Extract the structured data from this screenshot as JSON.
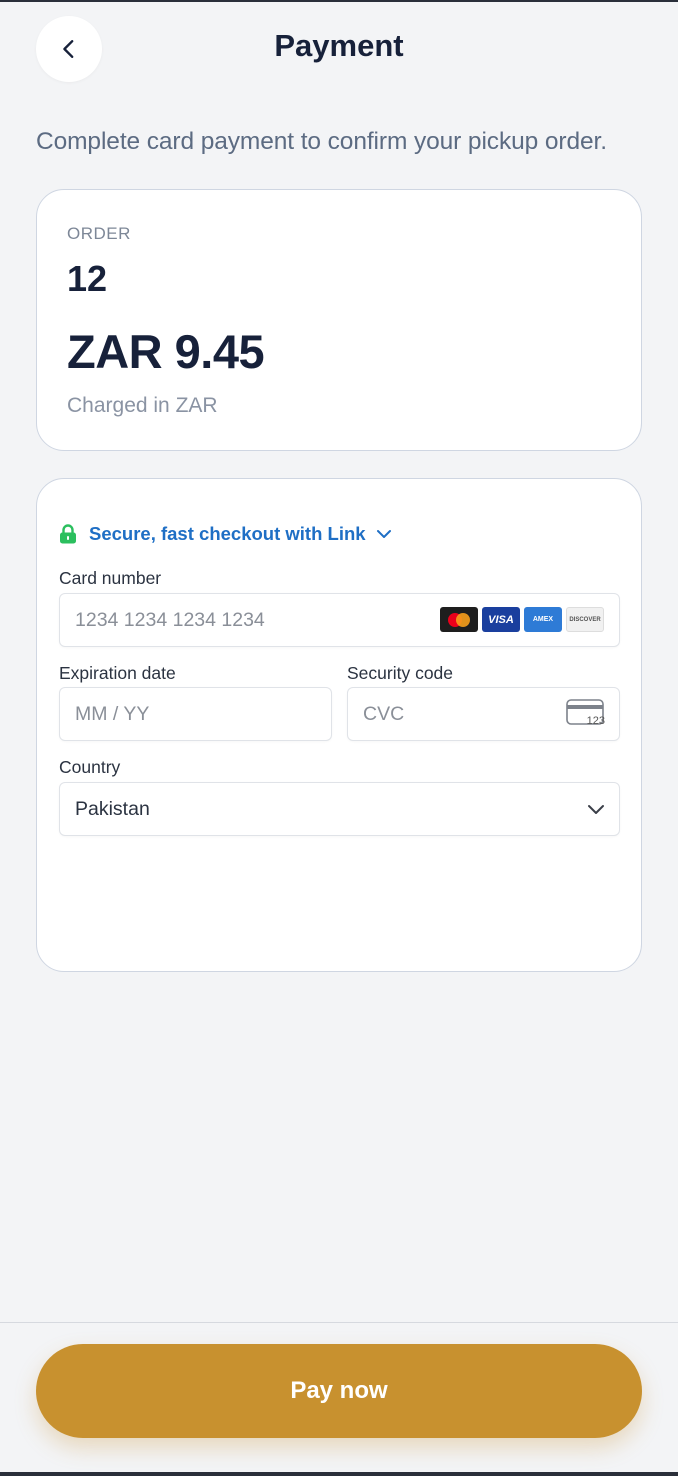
{
  "header": {
    "title": "Payment",
    "back_icon": "chevron-left-icon"
  },
  "subtitle": "Complete card payment to confirm your pickup order.",
  "order": {
    "label": "ORDER",
    "number": "12",
    "amount": "ZAR 9.45",
    "note": "Charged in ZAR"
  },
  "payment": {
    "link_text": "Secure, fast checkout with Link",
    "link_color": "#1f6fc5",
    "lock_color": "#2bbf5e",
    "card_number": {
      "label": "Card number",
      "placeholder": "1234 1234 1234 1234"
    },
    "brands": [
      "VISA",
      "AMEX",
      "DISCOVER"
    ],
    "expiration": {
      "label": "Expiration date",
      "placeholder": "MM / YY"
    },
    "security": {
      "label": "Security code",
      "placeholder": "CVC",
      "icon_text": "123"
    },
    "country": {
      "label": "Country",
      "value": "Pakistan"
    }
  },
  "footer": {
    "pay_label": "Pay now",
    "accent": "#c8912f"
  }
}
